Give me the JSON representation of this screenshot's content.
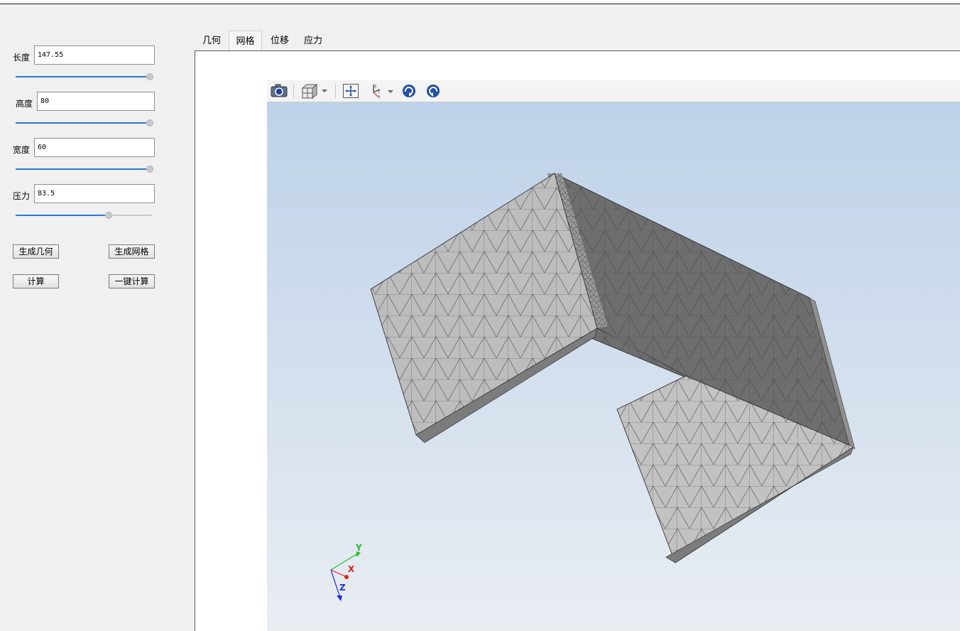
{
  "params": [
    {
      "label": "长度",
      "value": "147.55",
      "slider_pct": 100
    },
    {
      "label": "高度",
      "value": "80",
      "slider_pct": 100
    },
    {
      "label": "宽度",
      "value": "60",
      "slider_pct": 100
    },
    {
      "label": "压力",
      "value": "83.5",
      "slider_pct": 68
    }
  ],
  "buttons": {
    "gen_geometry": "生成几何",
    "gen_mesh": "生成网格",
    "compute": "计算",
    "one_click": "一键计算"
  },
  "tabs": [
    {
      "label": "几何",
      "active": false
    },
    {
      "label": "网格",
      "active": true
    },
    {
      "label": "位移",
      "active": false
    },
    {
      "label": "应力",
      "active": false
    }
  ],
  "toolbar_icons": [
    "camera-icon",
    "view-cube-icon",
    "fit-view-icon",
    "axes-icon",
    "rotate-cw-icon",
    "rotate-ccw-icon"
  ],
  "axes": {
    "x": "X",
    "y": "Y",
    "z": "Z",
    "x_color": "#e02020",
    "y_color": "#20c020",
    "z_color": "#2030e0"
  }
}
